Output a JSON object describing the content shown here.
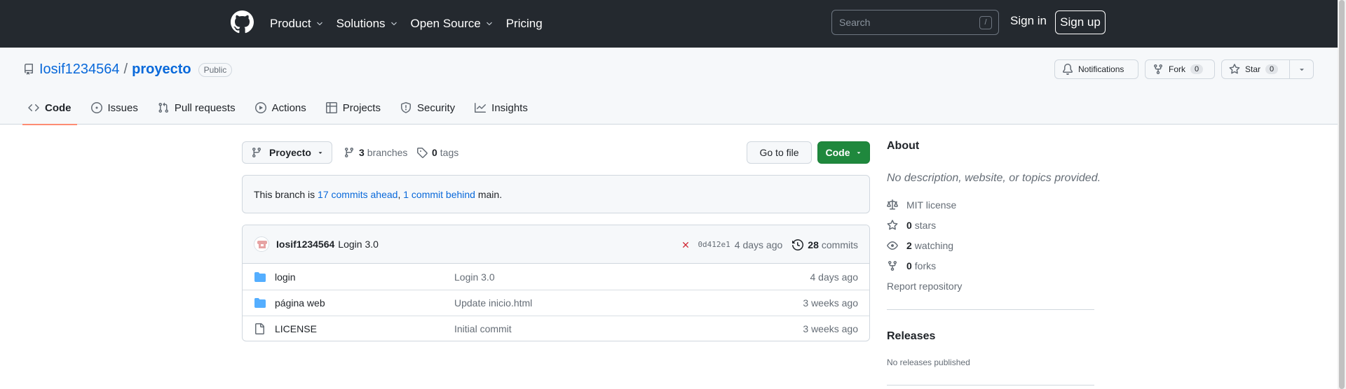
{
  "header": {
    "nav": [
      {
        "label": "Product",
        "dropdown": true
      },
      {
        "label": "Solutions",
        "dropdown": true
      },
      {
        "label": "Open Source",
        "dropdown": true
      },
      {
        "label": "Pricing",
        "dropdown": false
      }
    ],
    "search_placeholder": "Search",
    "search_shortcut": "/",
    "sign_in": "Sign in",
    "sign_up": "Sign up"
  },
  "repo": {
    "owner": "Iosif1234564",
    "separator": "/",
    "name": "proyecto",
    "visibility": "Public",
    "notifications_label": "Notifications",
    "fork_label": "Fork",
    "fork_count": "0",
    "star_label": "Star",
    "star_count": "0",
    "tabs": [
      {
        "label": "Code",
        "icon": "code-icon",
        "active": true
      },
      {
        "label": "Issues",
        "icon": "issue-opened-icon",
        "active": false
      },
      {
        "label": "Pull requests",
        "icon": "git-pull-request-icon",
        "active": false
      },
      {
        "label": "Actions",
        "icon": "play-icon",
        "active": false
      },
      {
        "label": "Projects",
        "icon": "table-icon",
        "active": false
      },
      {
        "label": "Security",
        "icon": "shield-icon",
        "active": false
      },
      {
        "label": "Insights",
        "icon": "graph-icon",
        "active": false
      }
    ]
  },
  "main": {
    "branch": "Proyecto",
    "branches_count": "3",
    "branches_label": "branches",
    "tags_count": "0",
    "tags_label": "tags",
    "go_to_file": "Go to file",
    "code_button": "Code",
    "branch_info": {
      "prefix": "This branch is",
      "ahead": "17 commits ahead",
      "comma": ",",
      "behind": "1 commit behind",
      "suffix": "main."
    },
    "latest_commit": {
      "author": "Iosif1234564",
      "message": "Login 3.0",
      "status": "failure",
      "sha": "0d412e1",
      "age": "4 days ago",
      "commits_count": "28",
      "commits_label": "commits"
    },
    "files": [
      {
        "type": "folder",
        "name": "login",
        "message": "Login 3.0",
        "age": "4 days ago"
      },
      {
        "type": "folder",
        "name": "página web",
        "message": "Update inicio.html",
        "age": "3 weeks ago"
      },
      {
        "type": "file",
        "name": "LICENSE",
        "message": "Initial commit",
        "age": "3 weeks ago"
      }
    ]
  },
  "sidebar": {
    "about_title": "About",
    "about_description": "No description, website, or topics provided.",
    "license": "MIT license",
    "stars_count": "0",
    "stars_label": "stars",
    "watching_count": "2",
    "watching_label": "watching",
    "forks_count": "0",
    "forks_label": "forks",
    "report": "Report repository",
    "releases_title": "Releases",
    "releases_none": "No releases published"
  },
  "colors": {
    "header_bg": "#24292f",
    "link": "#0969da",
    "primary_button": "#1f883d",
    "active_tab_underline": "#fd8c73",
    "folder": "#54aeff",
    "error": "#cf222e"
  }
}
